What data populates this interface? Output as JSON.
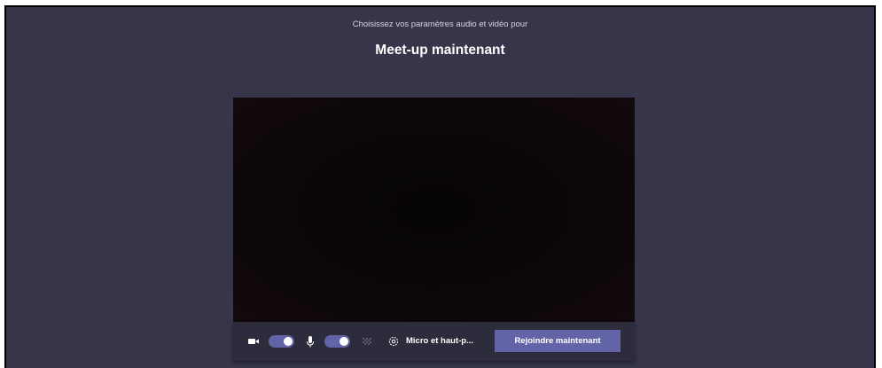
{
  "header": {
    "subtitle": "Choisissez vos paramètres audio et vidéo pour",
    "title": "Meet-up maintenant"
  },
  "controls": {
    "camera_toggle_on": true,
    "mic_toggle_on": true,
    "device_label": "Micro et haut-p...",
    "join_label": "Rejoindre maintenant"
  },
  "colors": {
    "background": "#36354a",
    "accent": "#6264a7",
    "controls_bar": "#2d2c3c"
  }
}
